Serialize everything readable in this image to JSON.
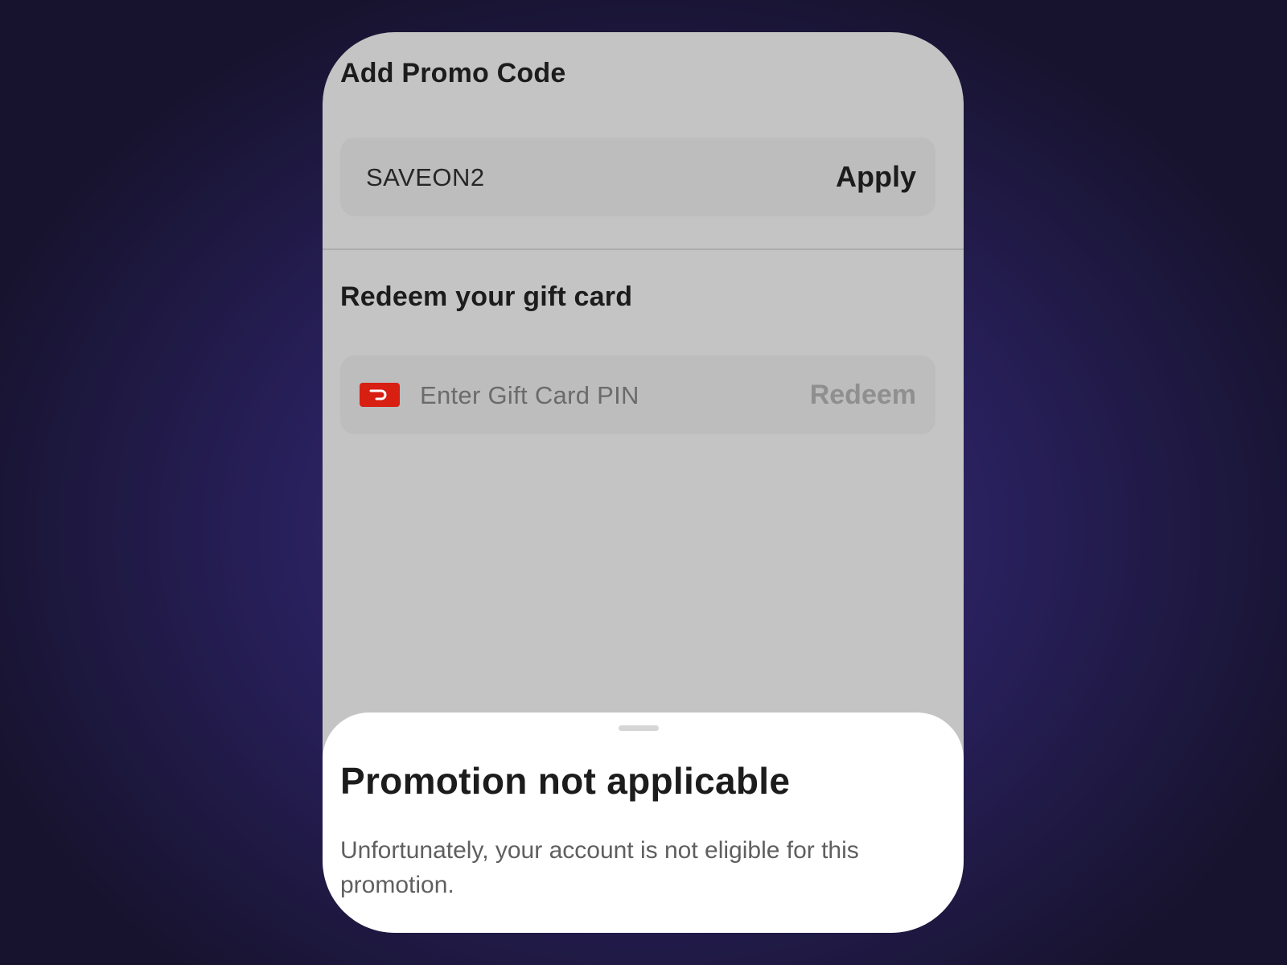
{
  "promo": {
    "title": "Add Promo Code",
    "code_value": "SAVEON2",
    "apply_label": "Apply"
  },
  "gift_card": {
    "title": "Redeem your gift card",
    "placeholder": "Enter Gift Card PIN",
    "redeem_label": "Redeem",
    "icon": "doordash-logo-icon"
  },
  "sheet": {
    "title": "Promotion not applicable",
    "message": "Unfortunately, your account is not eligible for this promotion."
  },
  "colors": {
    "background": "#2a2160",
    "screen_dim": "#c4c4c4",
    "brand_red": "#d71f12",
    "sheet": "#ffffff"
  }
}
